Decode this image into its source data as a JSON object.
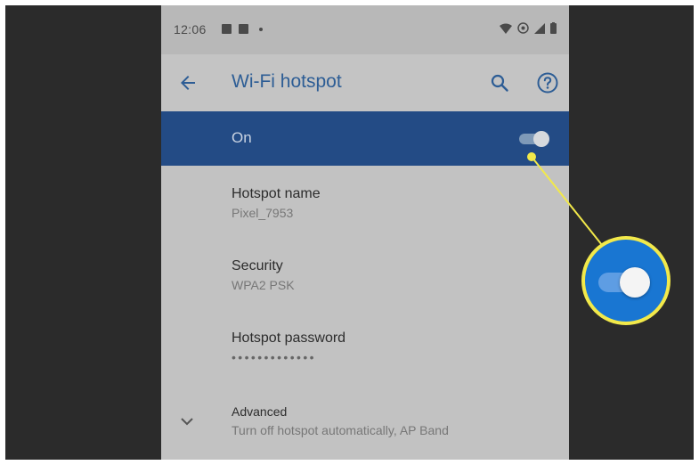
{
  "status_bar": {
    "time": "12:06"
  },
  "app_bar": {
    "title": "Wi-Fi hotspot",
    "back_icon": "arrow-back-icon",
    "search_icon": "search-icon",
    "help_icon": "help-icon"
  },
  "master_switch": {
    "label": "On",
    "state": "on"
  },
  "settings": {
    "hotspot_name": {
      "title": "Hotspot name",
      "value": "Pixel_7953"
    },
    "security": {
      "title": "Security",
      "value": "WPA2 PSK"
    },
    "password": {
      "title": "Hotspot password",
      "value": "•••••••••••••"
    },
    "advanced": {
      "title": "Advanced",
      "summary": "Turn off hotspot automatically, AP Band",
      "chevron_icon": "chevron-down-icon"
    }
  },
  "callout": {
    "description_icon": "toggle-on-icon",
    "ring_color": "#f2e94a",
    "fill_color": "#1976d2"
  },
  "colors": {
    "accent": "#2d5d95",
    "master_bar": "#234b85",
    "background_dim": "#c2c2c2",
    "frame": "#2b2b2b"
  }
}
